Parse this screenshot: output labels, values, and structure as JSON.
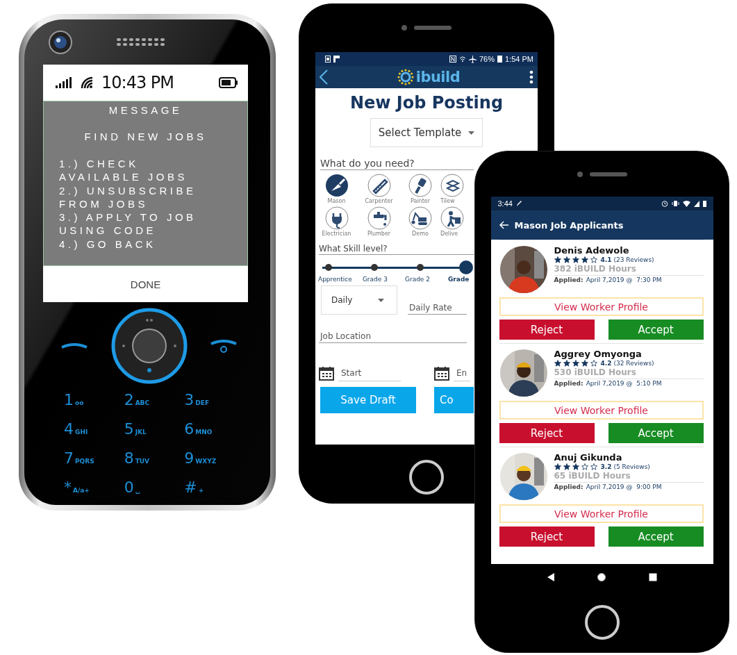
{
  "feature_phone": {
    "status_time": "10:43 PM",
    "message_title": "MESSAGE",
    "heading": "FIND NEW JOBS",
    "options": [
      "1.) CHECK AVAILABLE JOBS",
      "2.) UNSUBSCRIBE FROM JOBS",
      "3.) APPLY TO JOB USING CODE",
      "4.) GO BACK"
    ],
    "done_button": "DONE",
    "keys": [
      {
        "digit": "1",
        "letters": "oo"
      },
      {
        "digit": "2",
        "letters": "ABC"
      },
      {
        "digit": "3",
        "letters": "DEF"
      },
      {
        "digit": "4",
        "letters": "GHI"
      },
      {
        "digit": "5",
        "letters": "JKL"
      },
      {
        "digit": "6",
        "letters": "MNO"
      },
      {
        "digit": "7",
        "letters": "PQRS"
      },
      {
        "digit": "8",
        "letters": "TUV"
      },
      {
        "digit": "9",
        "letters": "WXYZ"
      },
      {
        "digit": "*",
        "letters": "A/a+"
      },
      {
        "digit": "0",
        "letters": "␣"
      },
      {
        "digit": "#",
        "letters": "+"
      }
    ]
  },
  "job_posting": {
    "status_battery": "76%",
    "status_time": "1:54 PM",
    "logo": "ibuild",
    "title": "New Job Posting",
    "template": "Select Template",
    "trades_label": "What do you need?",
    "trades": [
      {
        "label": "Mason",
        "selected": true
      },
      {
        "label": "Carpenter",
        "selected": false
      },
      {
        "label": "Painter",
        "selected": false
      },
      {
        "label": "Tilew",
        "selected": false
      },
      {
        "label": "Electrician",
        "selected": false
      },
      {
        "label": "Plumber",
        "selected": false
      },
      {
        "label": "Demo",
        "selected": false
      },
      {
        "label": "Delive",
        "selected": false
      }
    ],
    "skill_label": "What Skill level?",
    "skill_levels": [
      {
        "label": "Apprentice",
        "selected": false
      },
      {
        "label": "Grade 3",
        "selected": false
      },
      {
        "label": "Grade 2",
        "selected": false
      },
      {
        "label": "Grade",
        "selected": true
      }
    ],
    "rate_period": "Daily",
    "rate_placeholder": "Daily Rate",
    "location_placeholder": "Job Location",
    "start_placeholder": "Start",
    "end_placeholder": "En",
    "buttons": [
      "Save Draft",
      "Co"
    ]
  },
  "applicants": {
    "status_time": "3:44",
    "title": "Mason Job Applicants",
    "items": [
      {
        "name": "Denis Adewole",
        "stars": 4,
        "rating": "4.1",
        "reviews": "(23 Reviews)",
        "hours": "382 iBUILD Hours",
        "applied_label": "Applied:",
        "applied_at": "April 7,2019 @  7:30 PM",
        "profile_button": "View Worker Profile",
        "reject_button": "Reject",
        "accept_button": "Accept"
      },
      {
        "name": "Aggrey Omyonga",
        "stars": 4,
        "rating": "4.2",
        "reviews": "(32 Reviews)",
        "hours": "530 iBUILD Hours",
        "applied_label": "Applied:",
        "applied_at": "April 7,2019 @  5:10 PM",
        "profile_button": "View Worker Profile",
        "reject_button": "Reject",
        "accept_button": "Accept"
      },
      {
        "name": "Anuj Gikunda",
        "stars": 3,
        "rating": "3.2",
        "reviews": "(5 Reviews)",
        "hours": "65 iBUILD Hours",
        "applied_label": "Applied:",
        "applied_at": "April 7,2019 @  9:00 PM",
        "profile_button": "View Worker Profile",
        "reject_button": "Reject",
        "accept_button": "Accept"
      }
    ]
  }
}
